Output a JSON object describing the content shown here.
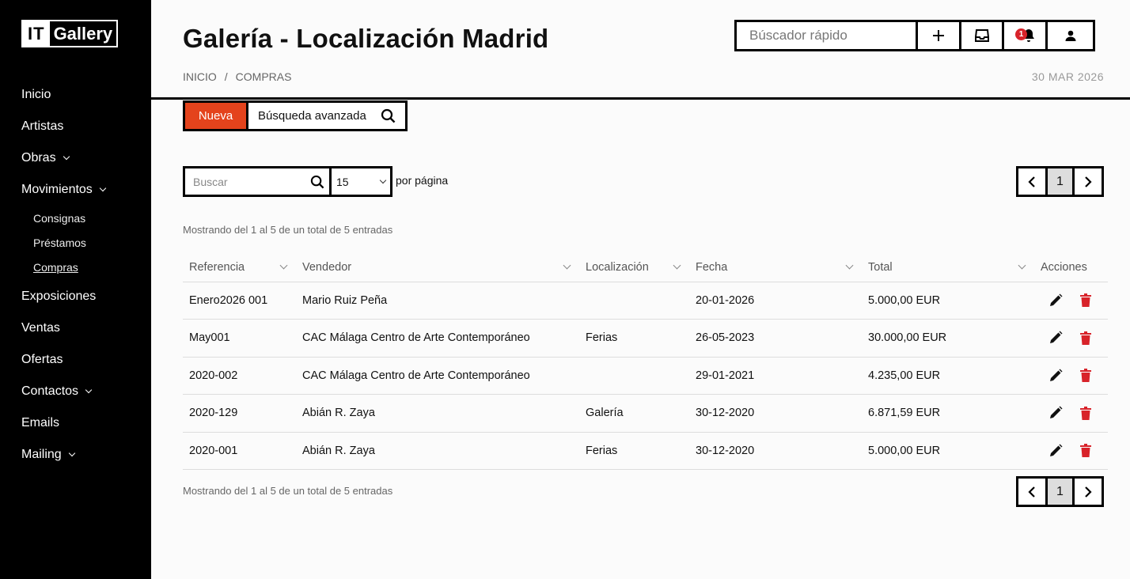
{
  "app": {
    "logo_it": "IT",
    "logo_name": "Gallery"
  },
  "sidebar": {
    "items": [
      {
        "label": "Inicio"
      },
      {
        "label": "Artistas"
      },
      {
        "label": "Obras"
      },
      {
        "label": "Movimientos"
      },
      {
        "label": "Consignas"
      },
      {
        "label": "Préstamos"
      },
      {
        "label": "Compras"
      },
      {
        "label": "Exposiciones"
      },
      {
        "label": "Ventas"
      },
      {
        "label": "Ofertas"
      },
      {
        "label": "Contactos"
      },
      {
        "label": "Emails"
      },
      {
        "label": "Mailing"
      }
    ]
  },
  "header": {
    "title": "Galería - Localización Madrid",
    "breadcrumb_home": "INICIO",
    "breadcrumb_sep": "/",
    "breadcrumb_current": "COMPRAS",
    "date": "30 MAR 2026",
    "quick_search_placeholder": "Búscador rápido",
    "notification_count": "1"
  },
  "toolbar": {
    "new_label": "Nueva",
    "advanced_search_label": "Búsqueda avanzada"
  },
  "filters": {
    "search_placeholder": "Buscar",
    "per_page_value": "15",
    "per_page_label": "por página"
  },
  "pagination": {
    "current_page": "1"
  },
  "info_text": "Mostrando del 1 al 5 de un total de 5 entradas",
  "table": {
    "headers": {
      "ref": "Referencia",
      "seller": "Vendedor",
      "location": "Localización",
      "date": "Fecha",
      "total": "Total",
      "actions": "Acciones"
    },
    "rows": [
      {
        "ref": "Enero2026 001",
        "seller": "Mario Ruiz Peña",
        "location": "",
        "date": "20-01-2026",
        "total": "5.000,00 EUR"
      },
      {
        "ref": "May001",
        "seller": "CAC Málaga Centro de Arte Contemporáneo",
        "location": "Ferias",
        "date": "26-05-2023",
        "total": "30.000,00 EUR"
      },
      {
        "ref": "2020-002",
        "seller": "CAC Málaga Centro de Arte Contemporáneo",
        "location": "",
        "date": "29-01-2021",
        "total": "4.235,00 EUR"
      },
      {
        "ref": "2020-129",
        "seller": "Abián R. Zaya",
        "location": "Galería",
        "date": "30-12-2020",
        "total": "6.871,59 EUR"
      },
      {
        "ref": "2020-001",
        "seller": "Abián R. Zaya",
        "location": "Ferias",
        "date": "30-12-2020",
        "total": "5.000,00 EUR"
      }
    ]
  },
  "colors": {
    "accent": "#e4431c",
    "delete": "#d8232a",
    "sidebar_bg": "#000000"
  }
}
